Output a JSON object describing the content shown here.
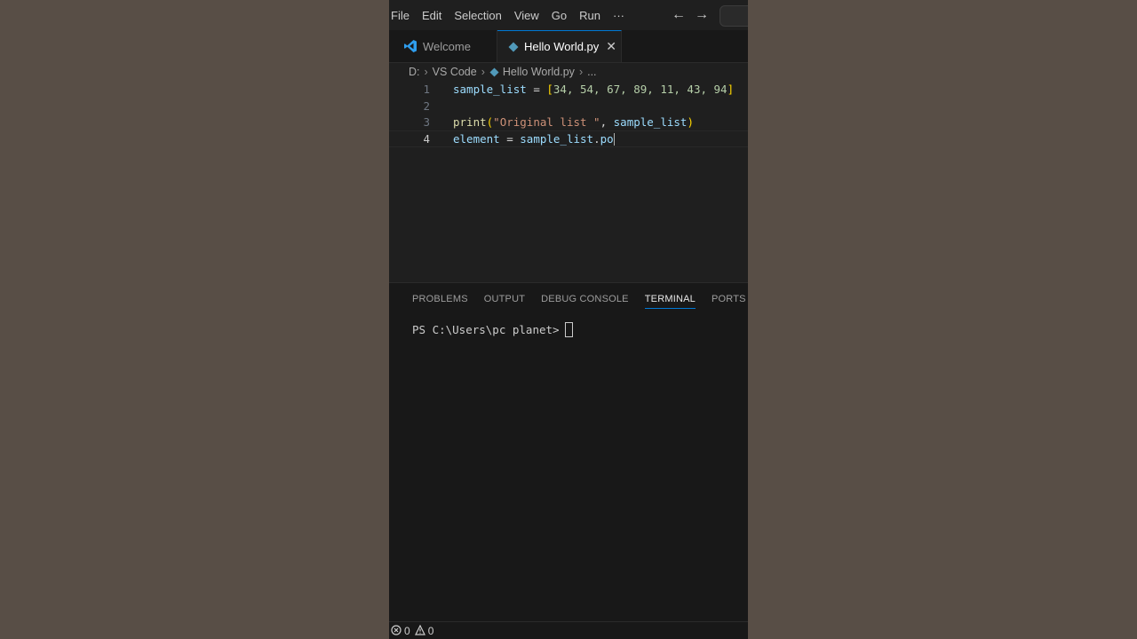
{
  "menubar": {
    "items": [
      "File",
      "Edit",
      "Selection",
      "View",
      "Go",
      "Run",
      "···"
    ],
    "back_icon": "arrow-left-icon",
    "forward_icon": "arrow-right-icon"
  },
  "tabs": {
    "welcome_label": "Welcome",
    "active_label": "Hello World.py",
    "close_icon": "close-icon"
  },
  "breadcrumb": {
    "drive": "D:",
    "folder": "VS Code",
    "file": "Hello World.py",
    "more": "..."
  },
  "editor": {
    "lines": [
      {
        "number": "1"
      },
      {
        "number": "2"
      },
      {
        "number": "3"
      },
      {
        "number": "4"
      }
    ],
    "line1": {
      "var": "sample_list",
      "op": " = ",
      "open": "[",
      "nums": "34, 54, 67, 89, 11, 43, 94",
      "close": "]"
    },
    "line3": {
      "fn": "print",
      "open": "(",
      "str": "\"Original list \"",
      "sep": ", ",
      "var": "sample_list",
      "close": ")"
    },
    "line4": {
      "var": "element",
      "op": " = ",
      "obj": "sample_list",
      "dot": ".",
      "partial": "po"
    },
    "active_line": "4"
  },
  "panel": {
    "tabs": [
      "PROBLEMS",
      "OUTPUT",
      "DEBUG CONSOLE",
      "TERMINAL",
      "PORTS"
    ],
    "active_tab": "TERMINAL",
    "terminal_prompt": "PS C:\\Users\\pc planet>"
  },
  "statusbar": {
    "errors": "0",
    "warnings": "0"
  },
  "colors": {
    "accent": "#0078d4",
    "editor_bg": "#1f1f1f",
    "page_bg": "#584e46"
  }
}
